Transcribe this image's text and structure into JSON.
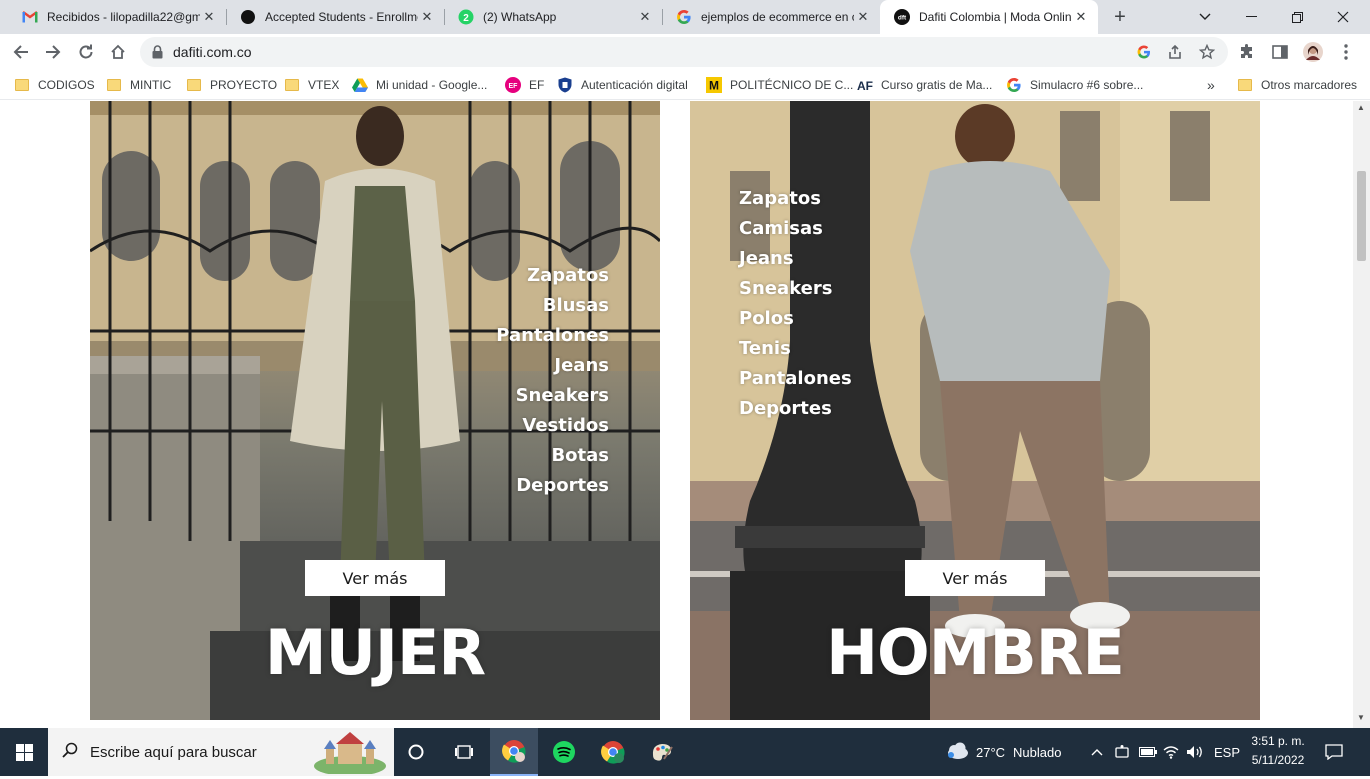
{
  "tabs": [
    {
      "title": "Recibidos - lilopadilla22@gm",
      "icon": "gmail-icon",
      "active": false
    },
    {
      "title": "Accepted Students - Enrollme",
      "icon": "github-icon",
      "active": false
    },
    {
      "title": "(2) WhatsApp",
      "icon": "whatsapp-icon",
      "badge": "2",
      "active": false
    },
    {
      "title": "ejemplos de ecommerce en c",
      "icon": "google-icon",
      "active": false
    },
    {
      "title": "Dafiti Colombia | Moda Onlin",
      "icon": "dafiti-icon",
      "favicon_text": "dft",
      "active": true
    }
  ],
  "address": {
    "url": "dafiti.com.co"
  },
  "bookmarks": [
    {
      "label": "CODIGOS",
      "icon": "folder-icon"
    },
    {
      "label": "MINTIC",
      "icon": "folder-icon"
    },
    {
      "label": "PROYECTO",
      "icon": "folder-icon"
    },
    {
      "label": "VTEX",
      "icon": "folder-icon"
    },
    {
      "label": "Mi unidad - Google...",
      "icon": "google-drive-icon"
    },
    {
      "label": "EF",
      "icon": "ef-icon",
      "icon_text": "EF"
    },
    {
      "label": "Autenticación digital",
      "icon": "shield-icon"
    },
    {
      "label": "POLITÉCNICO DE C...",
      "icon": "politecnico-icon",
      "icon_text": "M"
    },
    {
      "label": "Curso gratis de Ma...",
      "icon": "af-icon",
      "icon_text": "AF"
    },
    {
      "label": "Simulacro #6 sobre...",
      "icon": "google-icon"
    },
    {
      "label": "Otros marcadores",
      "icon": "folder-icon"
    }
  ],
  "bookmarks_more": "»",
  "banners": {
    "mujer": {
      "categories": [
        "Zapatos",
        "Blusas",
        "Pantalones",
        "Jeans",
        "Sneakers",
        "Vestidos",
        "Botas",
        "Deportes"
      ],
      "button": "Ver más",
      "title": "MUJER"
    },
    "hombre": {
      "categories": [
        "Zapatos",
        "Camisas",
        "Jeans",
        "Sneakers",
        "Polos",
        "Tenis",
        "Pantalones",
        "Deportes"
      ],
      "button": "Ver más",
      "title": "HOMBRE"
    }
  },
  "taskbar": {
    "search_placeholder": "Escribe aquí para buscar",
    "weather": {
      "temp": "27°C",
      "condition": "Nublado"
    },
    "language": "ESP",
    "time": "3:51 p. m.",
    "date": "5/11/2022"
  },
  "colors": {
    "tabstrip": "#dee1e6",
    "taskbar": "#1f2e3d",
    "accent": "#1a73e8"
  }
}
